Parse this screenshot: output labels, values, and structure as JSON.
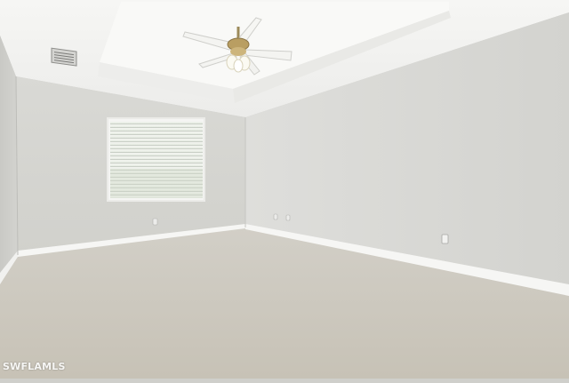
{
  "watermark": "SWFLAMLS",
  "colors": {
    "ceiling": "#f3f3f1",
    "tray_ceiling": "#f8f8f6",
    "back_wall": "#d6d6d2",
    "right_wall": "#dadad6",
    "left_wall": "#cfcfcb",
    "carpet": "#cbc7bd",
    "baseboard": "#f7f7f5",
    "window_light": "#e9ede6"
  },
  "objects": [
    "ceiling-fan-icon",
    "air-vent-icon",
    "window-blinds",
    "electrical-outlet-icon"
  ]
}
